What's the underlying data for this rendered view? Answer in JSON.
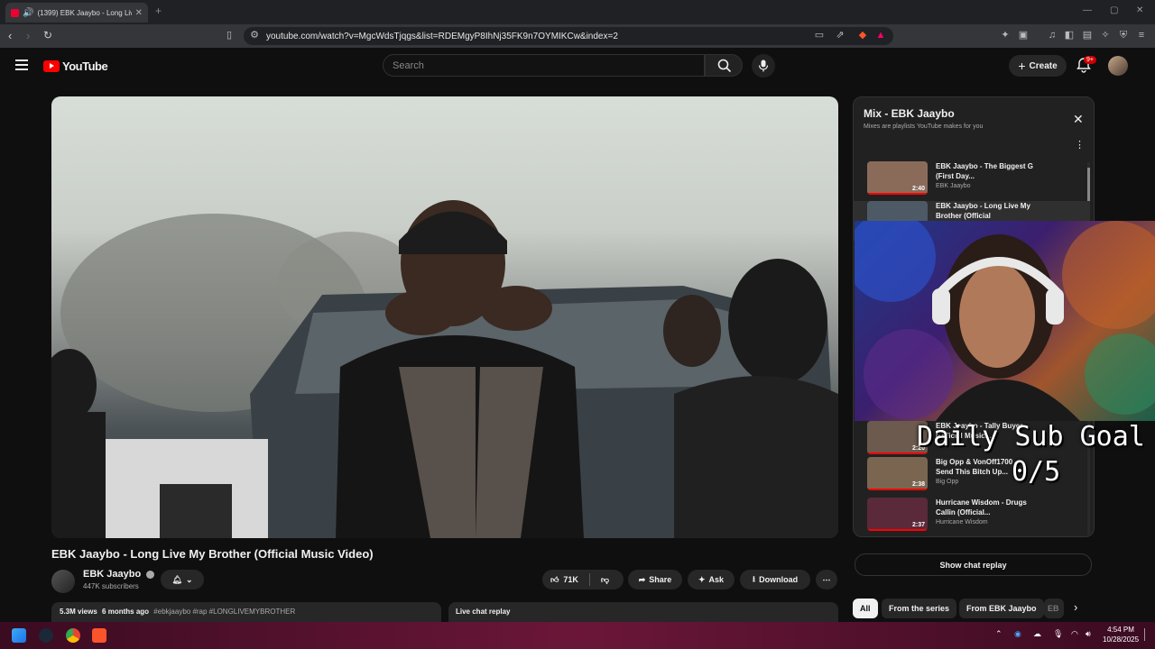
{
  "browser": {
    "tab_title": "(1399) EBK Jaaybo - Long Live",
    "url": "youtube.com/watch?v=MgcWdsTjqgs&list=RDEMgyP8IhNj35FK9n7OYMIKCw&index=2"
  },
  "header": {
    "logo_text": "YouTube",
    "search_placeholder": "Search",
    "create_label": "Create",
    "notif_count": "9+"
  },
  "video": {
    "title": "EBK Jaaybo - Long Live My Brother (Official Music Video)",
    "channel": "EBK Jaaybo",
    "subscribers": "447K subscribers",
    "likes": "71K",
    "share_label": "Share",
    "ask_label": "Ask",
    "download_label": "Download",
    "views": "5.3M views",
    "age": "6 months ago",
    "tags": "#ebkjaaybo #rap #LONGLIVEMYBROTHER",
    "live_chat_replay": "Live chat replay"
  },
  "playlist": {
    "title": "Mix - EBK Jaaybo",
    "subtitle": "Mixes are playlists YouTube makes for you",
    "items": [
      {
        "title": "EBK Jaaybo - The Biggest G (First Day...",
        "channel": "EBK Jaaybo",
        "duration": "2:40",
        "color": "#8a6b5a"
      },
      {
        "title": "EBK Jaaybo - Long Live My Brother (Official",
        "channel": "",
        "duration": "",
        "color": "#4d5a66"
      },
      {
        "title": "EBK Jaaybo - Tally Buyer (Official Music...",
        "channel": "",
        "duration": "2:20",
        "color": "#6b5a4d"
      },
      {
        "title": "Big Opp & VonOff1700 - Send This Bitch Up...",
        "channel": "Big Opp",
        "duration": "2:38",
        "color": "#7a6650"
      },
      {
        "title": "Hurricane Wisdom - Drugs Callin (Official...",
        "channel": "Hurricane Wisdom",
        "duration": "2:37",
        "color": "#5a2a3a"
      }
    ]
  },
  "overlay": {
    "goal_label": "Daily Sub Goal",
    "goal_value": "0/5"
  },
  "chat": {
    "show_replay": "Show chat replay"
  },
  "chips": [
    "All",
    "From the series",
    "From EBK Jaaybo",
    "EB"
  ],
  "taskbar": {
    "time": "4:54 PM",
    "date": "10/28/2025"
  }
}
